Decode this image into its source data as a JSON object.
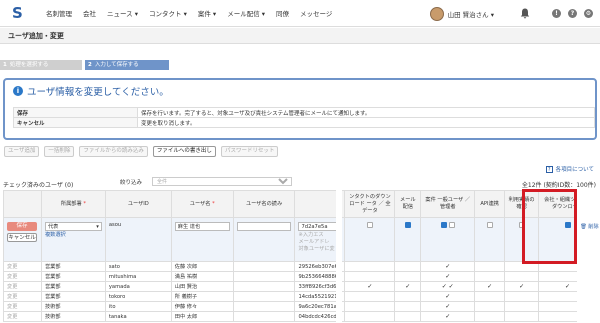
{
  "nav": {
    "logo": "S",
    "items": [
      "名刺管理",
      "会社",
      "ニュース ▾",
      "コンタクト ▾",
      "案件 ▾",
      "メール配信 ▾",
      "同僚",
      "メッセージ"
    ],
    "user": "山田 賢治さん ▾"
  },
  "page_title": "ユーザ追加・変更",
  "steps": [
    {
      "num": "1",
      "label": "処理を選択する"
    },
    {
      "num": "2",
      "label": "入力して保存する"
    }
  ],
  "alert": {
    "title": "ユーザ情報を変更してください。",
    "rows": [
      {
        "key": "保存",
        "value": "保存を行います。完了すると、対象ユーザ及び責社システム管理者にメールにて通知します。"
      },
      {
        "key": "キャンセル",
        "value": "変更を取り消します。"
      }
    ]
  },
  "buttons": [
    "ユーザ追加",
    "一括削除",
    "ファイルからの読み込み",
    "ファイルへの書き出し",
    "パスワードリセット"
  ],
  "help_link": "各項目について",
  "checked_count": "チェック済みのユーザ (0)",
  "filter_label": "絞り込み",
  "filter_placeholder": "全件",
  "total": "全12件 (契約ID数：100件)",
  "columns": {
    "dept": "所属部署",
    "uid": "ユーザID",
    "name": "ユーザ名",
    "kana": "ユーザ名の読み",
    "hash": "",
    "contact_dl": "ンタクトのダウンロード ータ ／ 全データ",
    "mail": "メール配信",
    "deal": "案件 一般ユーザ ／ 管理者",
    "api": "API連携",
    "usage": "利用実績の確認",
    "tree_dl": "会社・組織ツリーのダウンロード"
  },
  "edit_row": {
    "save": "保存",
    "cancel": "キャンセル",
    "dept": "代表",
    "dept_multi": "複数選択",
    "uid": "asou",
    "name": "麻生 達也",
    "hash": "7d2a7e5a",
    "hint1": "※入力エス",
    "hint2": "メールアドレ",
    "hint3": "対象ユーザに変",
    "delete": "削除"
  },
  "rows": [
    {
      "edit": "変更",
      "dept": "営業部",
      "uid": "sato",
      "name": "佐藤 次郎",
      "hash": "29526eb307e6"
    },
    {
      "edit": "変更",
      "dept": "営業部",
      "uid": "mitushima",
      "name": "満島 祐樹",
      "hash": "9b2536648886"
    },
    {
      "edit": "変更",
      "dept": "営業部",
      "uid": "yamada",
      "name": "山田 賢治",
      "hash": "33ff8926cf3d6"
    },
    {
      "edit": "変更",
      "dept": "営業部",
      "uid": "tokoro",
      "name": "所 義樹子",
      "hash": "14cda55219217"
    },
    {
      "edit": "変更",
      "dept": "技術部",
      "uid": "ito",
      "name": "伊藤 修々",
      "hash": "9a6c20ec781ad"
    },
    {
      "edit": "変更",
      "dept": "技術部",
      "uid": "tanaka",
      "name": "田中 太郎",
      "hash": "04bdcdc426cdf"
    }
  ],
  "colors": {
    "accent": "#2b5fa6",
    "highlight": "#d31b24",
    "save": "#e88a7e"
  }
}
